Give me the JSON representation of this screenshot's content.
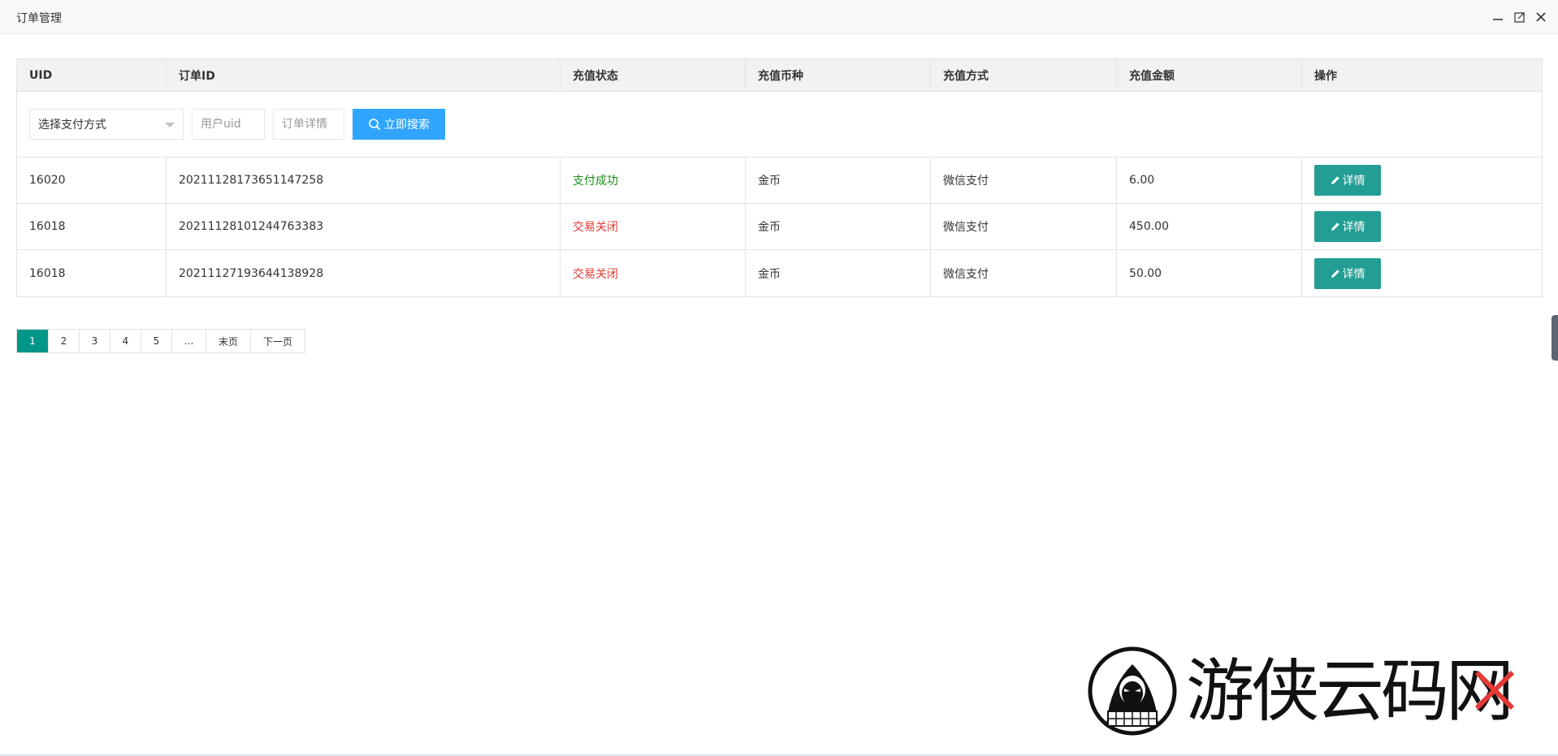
{
  "window": {
    "title": "订单管理"
  },
  "table": {
    "headers": [
      "UID",
      "订单ID",
      "充值状态",
      "充值币种",
      "充值方式",
      "充值金额",
      "操作"
    ],
    "rows": [
      {
        "uid": "16020",
        "order_id": "20211128173651147258",
        "status": "支付成功",
        "currency": "金币",
        "method": "微信支付",
        "amount": "6.00",
        "action": "详情"
      },
      {
        "uid": "16018",
        "order_id": "20211128101244763383",
        "status": "交易关闭",
        "currency": "金币",
        "method": "微信支付",
        "amount": "450.00",
        "action": "详情"
      },
      {
        "uid": "16018",
        "order_id": "20211127193644138928",
        "status": "交易关闭",
        "currency": "金币",
        "method": "微信支付",
        "amount": "50.00",
        "action": "详情"
      }
    ]
  },
  "filter": {
    "pay_method_selected": "选择支付方式",
    "uid_placeholder": "用户uid",
    "detail_placeholder": "订单详情",
    "search_label": "立即搜索"
  },
  "pagination": {
    "pages": [
      "1",
      "2",
      "3",
      "4",
      "5",
      "…",
      "末页",
      "下一页"
    ],
    "current": "1"
  },
  "logo": {
    "text": "游侠云码网"
  },
  "colors": {
    "success": "#1a8f1a",
    "closed": "#e53935",
    "search_button": "#30a5ff",
    "detail_button": "#239e94",
    "active_page": "#009688"
  },
  "icons": {
    "minimize": "minimize-icon",
    "maximize": "maximize-icon",
    "close": "close-icon",
    "search": "search-icon",
    "edit": "pencil-icon",
    "dropdown": "chevron-down-icon"
  }
}
